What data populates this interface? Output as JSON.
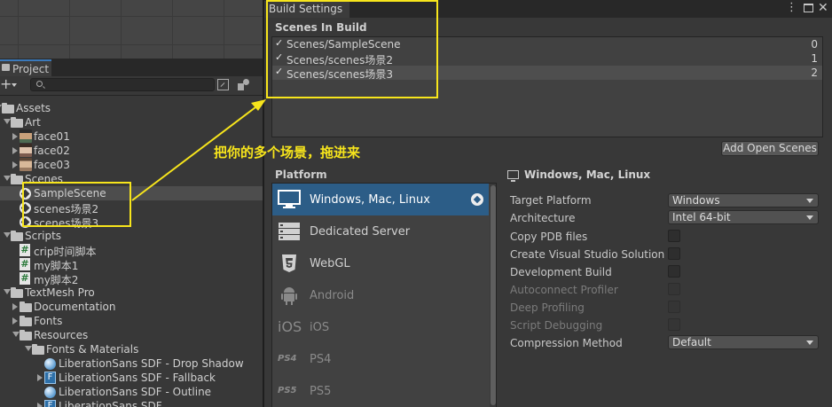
{
  "project": {
    "tab_label": "Project",
    "search": {
      "value": "",
      "placeholder": ""
    },
    "tree": [
      {
        "label": "Assets",
        "icon": "folder-open-icon",
        "expand": "down",
        "selected": false
      },
      {
        "label": "Art",
        "icon": "folder-open-icon",
        "expand": "down",
        "selected": false
      },
      {
        "label": "face01",
        "icon": "image-icon",
        "expand": "right",
        "selected": false,
        "thumb_colors": [
          "#4e6b52",
          "#c8a07a",
          "#2a2a2a"
        ]
      },
      {
        "label": "face02",
        "icon": "image-icon",
        "expand": "right",
        "selected": false,
        "thumb_colors": [
          "#7c5b4e",
          "#e0c4ad",
          "#3a2b23"
        ]
      },
      {
        "label": "face03",
        "icon": "image-icon",
        "expand": "right",
        "selected": false,
        "thumb_colors": [
          "#9a7a61",
          "#d8b899",
          "#5b4535"
        ]
      },
      {
        "label": "Scenes",
        "icon": "folder-open-icon",
        "expand": "down",
        "selected": false
      },
      {
        "label": "SampleScene",
        "icon": "unity-scene-icon",
        "expand": "none",
        "selected": true
      },
      {
        "label": "scenes场景2",
        "icon": "unity-scene-icon",
        "expand": "none",
        "selected": false
      },
      {
        "label": "scenes场景3",
        "icon": "unity-scene-icon",
        "expand": "none",
        "selected": false
      },
      {
        "label": "Scripts",
        "icon": "folder-open-icon",
        "expand": "down",
        "selected": false
      },
      {
        "label": "crip时间脚本",
        "icon": "script-icon",
        "expand": "none",
        "selected": false
      },
      {
        "label": "my脚本1",
        "icon": "script-icon",
        "expand": "none",
        "selected": false
      },
      {
        "label": "my脚本2",
        "icon": "script-icon",
        "expand": "none",
        "selected": false
      },
      {
        "label": "TextMesh Pro",
        "icon": "folder-open-icon",
        "expand": "down",
        "selected": false
      },
      {
        "label": "Documentation",
        "icon": "folder-icon",
        "expand": "right",
        "selected": false
      },
      {
        "label": "Fonts",
        "icon": "folder-icon",
        "expand": "right",
        "selected": false
      },
      {
        "label": "Resources",
        "icon": "folder-open-icon",
        "expand": "down",
        "selected": false
      },
      {
        "label": "Fonts & Materials",
        "icon": "folder-open-icon",
        "expand": "down",
        "selected": false
      },
      {
        "label": "LiberationSans SDF - Drop Shadow",
        "icon": "material-icon",
        "expand": "none",
        "selected": false
      },
      {
        "label": "LiberationSans SDF - Fallback",
        "icon": "font-asset-icon",
        "expand": "right",
        "selected": false
      },
      {
        "label": "LiberationSans SDF - Outline",
        "icon": "material-icon",
        "expand": "none",
        "selected": false
      },
      {
        "label": "LiberationSans SDF",
        "icon": "font-asset-icon",
        "expand": "right",
        "selected": false
      }
    ],
    "icon_glyphs": {
      "script": "#",
      "font": "F"
    }
  },
  "build": {
    "tab_label": "Build Settings",
    "scenes_heading": "Scenes In Build",
    "scenes": [
      {
        "name": "Scenes/SampleScene",
        "index": "0",
        "checked": "✓",
        "selected": false
      },
      {
        "name": "Scenes/scenes场景2",
        "index": "1",
        "checked": "✓",
        "selected": false
      },
      {
        "name": "Scenes/scenes场景3",
        "index": "2",
        "checked": "✓",
        "selected": true
      }
    ],
    "add_open_scenes_label": "Add Open Scenes",
    "platform_heading": "Platform",
    "platforms": [
      {
        "label": "Windows, Mac, Linux",
        "icon": "monitor-icon",
        "active": true,
        "dim": false
      },
      {
        "label": "Dedicated Server",
        "icon": "server-icon",
        "active": false,
        "dim": false
      },
      {
        "label": "WebGL",
        "icon": "html5-icon",
        "active": false,
        "dim": false
      },
      {
        "label": "Android",
        "icon": "android-icon",
        "active": false,
        "dim": true
      },
      {
        "label": "iOS",
        "icon": "ios-icon",
        "active": false,
        "dim": true,
        "icon_text": "iOS"
      },
      {
        "label": "PS4",
        "icon": "ps4-icon",
        "active": false,
        "dim": true,
        "icon_text": "PS4"
      },
      {
        "label": "PS5",
        "icon": "ps5-icon",
        "active": false,
        "dim": true,
        "icon_text": "PS5"
      }
    ],
    "settings_header": "Windows, Mac, Linux",
    "settings": {
      "target_platform": {
        "label": "Target Platform",
        "value": "Windows"
      },
      "architecture": {
        "label": "Architecture",
        "value": "Intel 64-bit"
      },
      "copy_pdb": {
        "label": "Copy PDB files"
      },
      "create_vs": {
        "label": "Create Visual Studio Solution"
      },
      "dev_build": {
        "label": "Development Build"
      },
      "autoconnect": {
        "label": "Autoconnect Profiler"
      },
      "deep_profiling": {
        "label": "Deep Profiling"
      },
      "script_debugging": {
        "label": "Script Debugging"
      },
      "compression": {
        "label": "Compression Method",
        "value": "Default"
      }
    }
  },
  "annotation": {
    "text": "把你的多个场景，拖进来",
    "color": "#f7e51c"
  },
  "colors": {
    "accent_blue": "#2c5d87",
    "selection": "#4d4d4d",
    "panel": "#383838"
  }
}
